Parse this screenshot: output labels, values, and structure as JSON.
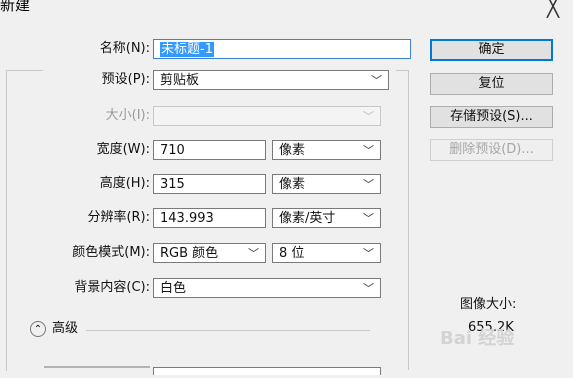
{
  "window": {
    "title": "新建",
    "close_glyph": "╳"
  },
  "form": {
    "name": {
      "label": "名称(N):",
      "value": "未标题-1"
    },
    "preset": {
      "label": "预设(P):",
      "value": "剪贴板"
    },
    "size": {
      "label": "大小(I):",
      "value": ""
    },
    "width": {
      "label": "宽度(W):",
      "value": "710",
      "unit": "像素"
    },
    "height": {
      "label": "高度(H):",
      "value": "315",
      "unit": "像素"
    },
    "resolution": {
      "label": "分辨率(R):",
      "value": "143.993",
      "unit": "像素/英寸"
    },
    "color_mode": {
      "label": "颜色模式(M):",
      "value": "RGB 颜色",
      "depth": "8 位"
    },
    "background": {
      "label": "背景内容(C):",
      "value": "白色"
    },
    "advanced": {
      "label": "高级"
    }
  },
  "buttons": {
    "ok": "确定",
    "reset": "复位",
    "save_preset": "存储预设(S)...",
    "delete_preset": "删除预设(D)..."
  },
  "info": {
    "label": "图像大小:",
    "value": "655.2K"
  },
  "watermark": "Bai 经验"
}
